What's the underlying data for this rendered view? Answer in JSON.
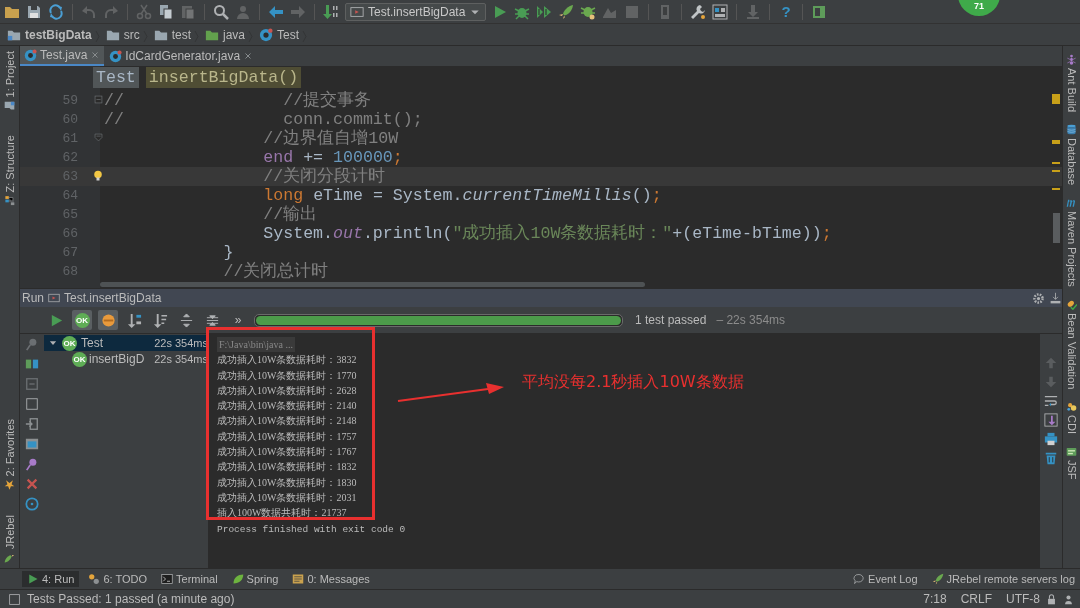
{
  "floating_badge": "71",
  "toolbar": {
    "groups": [
      [
        {
          "kind": "open",
          "disabled": false
        },
        {
          "kind": "save",
          "disabled": false
        },
        {
          "kind": "sync",
          "disabled": false
        }
      ],
      [
        {
          "kind": "undo",
          "disabled": true
        },
        {
          "kind": "redo",
          "disabled": true
        }
      ],
      [
        {
          "kind": "cut",
          "disabled": true
        },
        {
          "kind": "copy",
          "disabled": false
        },
        {
          "kind": "paste",
          "disabled": true
        }
      ],
      [
        {
          "kind": "find",
          "disabled": false
        },
        {
          "kind": "usages",
          "disabled": true
        }
      ],
      [
        {
          "kind": "back",
          "disabled": false
        },
        {
          "kind": "forward",
          "disabled": true
        }
      ],
      [
        {
          "kind": "build",
          "disabled": false
        },
        {
          "kind": "run-config",
          "label": "Test.insertBigData",
          "disabled": false
        },
        {
          "kind": "run",
          "disabled": false
        },
        {
          "kind": "debug",
          "disabled": false
        },
        {
          "kind": "coverage",
          "disabled": false
        },
        {
          "kind": "rebel-run",
          "disabled": false
        },
        {
          "kind": "rebel-debug",
          "disabled": false
        },
        {
          "kind": "profile",
          "disabled": true
        },
        {
          "kind": "stop",
          "disabled": true
        }
      ],
      [
        {
          "kind": "sdk",
          "disabled": true
        }
      ],
      [
        {
          "kind": "settings",
          "disabled": false
        },
        {
          "kind": "structure",
          "disabled": false
        }
      ],
      [
        {
          "kind": "update",
          "disabled": true
        }
      ],
      [
        {
          "kind": "help",
          "label": "?",
          "disabled": false
        }
      ],
      [
        {
          "kind": "panel",
          "disabled": false
        }
      ]
    ]
  },
  "navbar": [
    {
      "label": "testBigData",
      "kind": "project"
    },
    {
      "label": "src",
      "kind": "folder"
    },
    {
      "label": "test",
      "kind": "folder"
    },
    {
      "label": "java",
      "kind": "source"
    },
    {
      "label": "Test",
      "kind": "class"
    }
  ],
  "left_strip": {
    "top": [
      {
        "label": "1: Project",
        "kind": "project"
      },
      {
        "label": "Z: Structure",
        "kind": "structure"
      }
    ],
    "bottom": [
      {
        "label": "2: Favorites",
        "kind": "favorites"
      },
      {
        "label": "JRebel",
        "kind": "jrebel"
      }
    ]
  },
  "editor_tabs": [
    {
      "label": "Test.java",
      "selected": true
    },
    {
      "label": "IdCardGenerator.java",
      "selected": false
    }
  ],
  "editor": {
    "breadcrumb": [
      "Test",
      "insertBigData()"
    ],
    "lines": [
      {
        "number": "59",
        "fold_start": true,
        "fold_end": false,
        "current": false,
        "bulb": false,
        "tokens": [
          {
            "kind": "comment",
            "text": "//                //提交事务"
          }
        ]
      },
      {
        "number": "60",
        "fold_start": false,
        "fold_end": false,
        "current": false,
        "bulb": false,
        "tokens": [
          {
            "kind": "comment",
            "text": "//                conn.commit();"
          }
        ]
      },
      {
        "number": "61",
        "fold_start": false,
        "fold_end": true,
        "current": false,
        "bulb": false,
        "tokens": [
          {
            "kind": "comment",
            "text": "                //边界值自增10W"
          }
        ]
      },
      {
        "number": "62",
        "fold_start": false,
        "fold_end": false,
        "current": false,
        "bulb": false,
        "tokens": [
          {
            "kind": "field",
            "text": "                end"
          },
          {
            "kind": "plain",
            "text": " += "
          },
          {
            "kind": "number",
            "text": "100000"
          },
          {
            "kind": "punct",
            "text": ";"
          }
        ]
      },
      {
        "number": "63",
        "fold_start": false,
        "fold_end": false,
        "current": true,
        "bulb": true,
        "tokens": [
          {
            "kind": "comment",
            "text": "                //关闭分段计时"
          }
        ]
      },
      {
        "number": "64",
        "fold_start": false,
        "fold_end": false,
        "current": false,
        "bulb": false,
        "tokens": [
          {
            "kind": "keyword",
            "text": "                long"
          },
          {
            "kind": "plain",
            "text": " eTime = System."
          },
          {
            "kind": "static",
            "text": "currentTimeMillis"
          },
          {
            "kind": "plain",
            "text": "()"
          },
          {
            "kind": "punct",
            "text": ";"
          }
        ]
      },
      {
        "number": "65",
        "fold_start": false,
        "fold_end": false,
        "current": false,
        "bulb": false,
        "tokens": [
          {
            "kind": "comment",
            "text": "                //输出"
          }
        ]
      },
      {
        "number": "66",
        "fold_start": false,
        "fold_end": false,
        "current": false,
        "bulb": false,
        "tokens": [
          {
            "kind": "plain",
            "text": "                System."
          },
          {
            "kind": "static-field",
            "text": "out"
          },
          {
            "kind": "plain",
            "text": ".println("
          },
          {
            "kind": "string",
            "text": "\"成功插入10W条数据耗时：\""
          },
          {
            "kind": "plain",
            "text": "+(eTime-bTime))"
          },
          {
            "kind": "punct",
            "text": ";"
          }
        ]
      },
      {
        "number": "67",
        "fold_start": false,
        "fold_end": false,
        "current": false,
        "bulb": false,
        "tokens": [
          {
            "kind": "plain",
            "text": "            }"
          }
        ]
      },
      {
        "number": "68",
        "fold_start": false,
        "fold_end": false,
        "current": false,
        "bulb": false,
        "tokens": [
          {
            "kind": "comment",
            "text": "            //关闭总计时"
          }
        ]
      }
    ]
  },
  "right_strip": [
    {
      "label": "Ant Build",
      "kind": "ant"
    },
    {
      "label": "Database",
      "kind": "database"
    },
    {
      "label": "Maven Projects",
      "kind": "maven"
    },
    {
      "label": "Bean Validation",
      "kind": "bean"
    },
    {
      "label": "CDI",
      "kind": "cdi"
    },
    {
      "label": "JSF",
      "kind": "jsf"
    }
  ],
  "run_panel": {
    "title": "Run",
    "config": "Test.insertBigData",
    "toolbar": [
      {
        "kind": "rerun",
        "on": false
      },
      {
        "kind": "show-passed",
        "badge": "OK",
        "on": true
      },
      {
        "kind": "show-ignored",
        "on": true
      },
      {
        "kind": "sort-alpha",
        "on": false
      },
      {
        "kind": "sort-duration",
        "on": false
      },
      {
        "kind": "expand",
        "on": false
      },
      {
        "kind": "collapse",
        "on": false
      }
    ],
    "more": "»",
    "progress": {
      "level": 1
    },
    "result": "1 test passed",
    "duration": "– 22s 354ms",
    "tree": [
      {
        "label": "Test",
        "status": "OK",
        "time": "22s 354ms",
        "expanded": true,
        "selected": true,
        "children": [
          {
            "label": "insertBigD",
            "status": "OK",
            "time": "22s 354ms",
            "selected": false
          }
        ]
      }
    ],
    "console": [
      {
        "kind": "command",
        "text": "F:\\Java\\bin\\java ..."
      },
      {
        "kind": "output",
        "text": "成功插入10W条数据耗时：3832"
      },
      {
        "kind": "output",
        "text": "成功插入10W条数据耗时：1770"
      },
      {
        "kind": "output",
        "text": "成功插入10W条数据耗时：2628"
      },
      {
        "kind": "output",
        "text": "成功插入10W条数据耗时：2140"
      },
      {
        "kind": "output",
        "text": "成功插入10W条数据耗时：2148"
      },
      {
        "kind": "output",
        "text": "成功插入10W条数据耗时：1757"
      },
      {
        "kind": "output",
        "text": "成功插入10W条数据耗时：1767"
      },
      {
        "kind": "output",
        "text": "成功插入10W条数据耗时：1832"
      },
      {
        "kind": "output",
        "text": "成功插入10W条数据耗时：1830"
      },
      {
        "kind": "output",
        "text": "成功插入10W条数据耗时：2031"
      },
      {
        "kind": "output",
        "text": "插入100W数据共耗时：21737"
      },
      {
        "kind": "exit",
        "text": "Process finished with exit code 0"
      }
    ]
  },
  "bottom_tabs": {
    "left": [
      {
        "label": "4: Run",
        "kind": "run",
        "selected": true
      },
      {
        "label": "6: TODO",
        "kind": "todo",
        "selected": false
      },
      {
        "label": "Terminal",
        "kind": "terminal",
        "selected": false
      },
      {
        "label": "Spring",
        "kind": "spring",
        "selected": false
      },
      {
        "label": "0: Messages",
        "kind": "messages",
        "selected": false
      }
    ],
    "right": [
      {
        "label": "Event Log",
        "kind": "log",
        "selected": false
      },
      {
        "label": "JRebel remote servers log",
        "kind": "rebel-run",
        "selected": false
      }
    ]
  },
  "status_bar": {
    "message": "Tests Passed: 1 passed (a minute ago)",
    "position": "7:18",
    "line_separator": "CRLF",
    "encoding": "UTF-8"
  },
  "annotation": {
    "text": "平均没每2.1秒插入10W条数据"
  }
}
